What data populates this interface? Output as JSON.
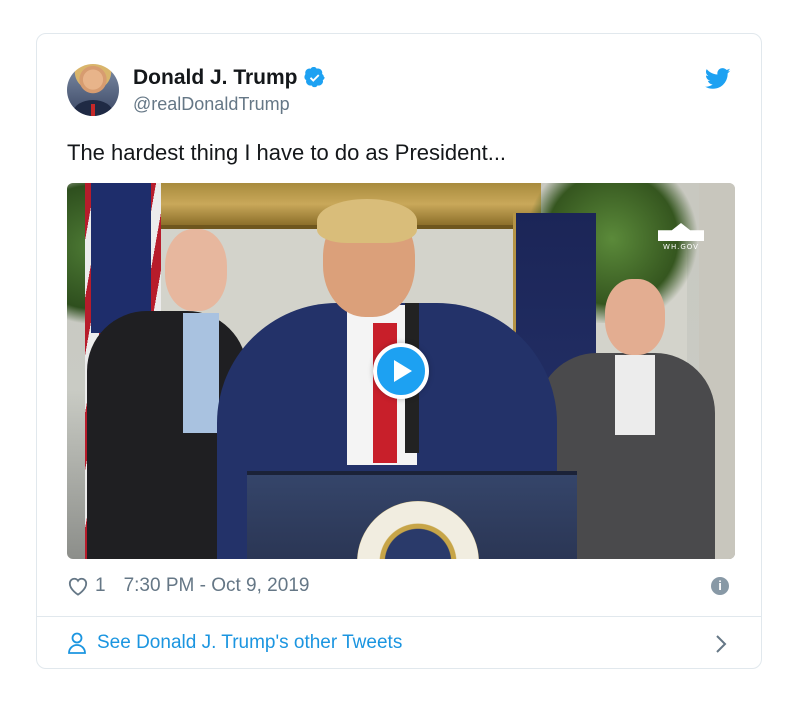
{
  "tweet": {
    "author_name": "Donald J. Trump",
    "author_handle": "@realDonaldTrump",
    "verified": true,
    "text": "The hardest thing I have to do as President...",
    "media": {
      "type": "video",
      "watermark": "WH.GOV"
    },
    "like_count": "1",
    "timestamp": "7:30 PM - Oct 9, 2019",
    "footer_link": "See Donald J. Trump's other Tweets"
  },
  "icons": {
    "verified": "verified-badge-icon",
    "brand": "twitter-bird-icon",
    "play": "play-icon",
    "like": "heart-icon",
    "info": "info-icon",
    "profile": "person-icon",
    "next": "chevron-right-icon"
  },
  "colors": {
    "brand_blue": "#1da1f2",
    "link_blue": "#1b95e0",
    "text_primary": "#14171a",
    "text_secondary": "#657786",
    "border": "#e1e8ed"
  }
}
